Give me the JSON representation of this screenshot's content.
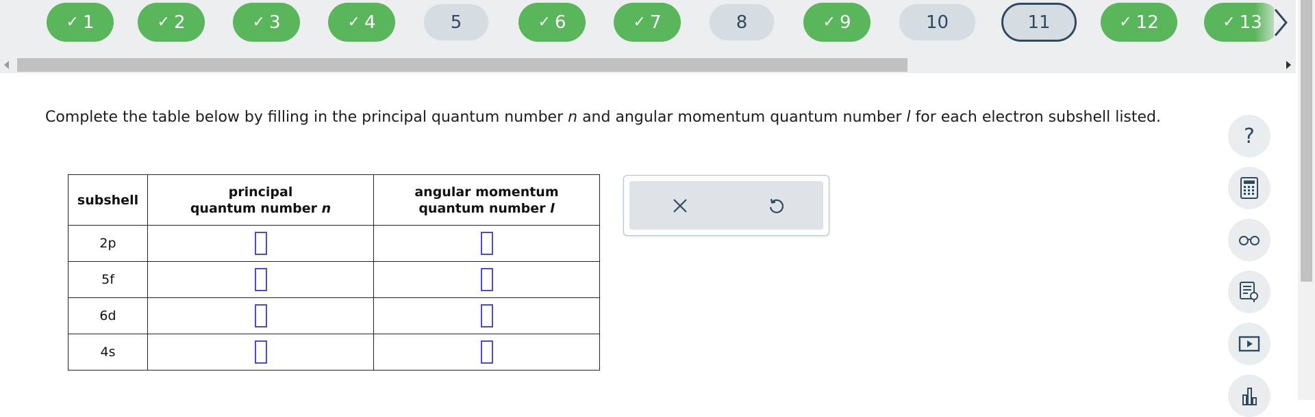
{
  "nav": {
    "questions": [
      {
        "label": "1",
        "state": "done"
      },
      {
        "label": "2",
        "state": "done"
      },
      {
        "label": "3",
        "state": "done"
      },
      {
        "label": "4",
        "state": "done"
      },
      {
        "label": "5",
        "state": "todo"
      },
      {
        "label": "6",
        "state": "done"
      },
      {
        "label": "7",
        "state": "done"
      },
      {
        "label": "8",
        "state": "todo"
      },
      {
        "label": "9",
        "state": "done"
      },
      {
        "label": "10",
        "state": "todo"
      },
      {
        "label": "11",
        "state": "current"
      },
      {
        "label": "12",
        "state": "done"
      },
      {
        "label": "13",
        "state": "done"
      }
    ],
    "check_glyph": "✓"
  },
  "question": {
    "part1": "Complete the table below by filling in the principal quantum number ",
    "var_n": "n",
    "part2": " and angular momentum quantum number ",
    "var_l": "l",
    "part3": " for each electron subshell listed."
  },
  "table": {
    "header_subshell": "subshell",
    "header_n_line1": "principal",
    "header_n_line2": "quantum number ",
    "header_n_var": "n",
    "header_l_line1": "angular momentum",
    "header_l_line2": "quantum number ",
    "header_l_var": "l",
    "rows": [
      {
        "subshell": "2p",
        "n": "",
        "l": ""
      },
      {
        "subshell": "5f",
        "n": "",
        "l": ""
      },
      {
        "subshell": "6d",
        "n": "",
        "l": ""
      },
      {
        "subshell": "4s",
        "n": "",
        "l": ""
      }
    ]
  },
  "toolbox": {
    "clear_icon": "close-icon",
    "undo_icon": "undo-icon"
  },
  "sidebar": {
    "help_glyph": "?",
    "tools": [
      "help-icon",
      "calculator-icon",
      "glasses-icon",
      "notes-icon",
      "video-icon",
      "chart-icon"
    ]
  },
  "colors": {
    "done": "#5ab65a",
    "todo": "#d6dde2",
    "accent": "#2f4a5f",
    "answer_box": "#4949e0"
  }
}
